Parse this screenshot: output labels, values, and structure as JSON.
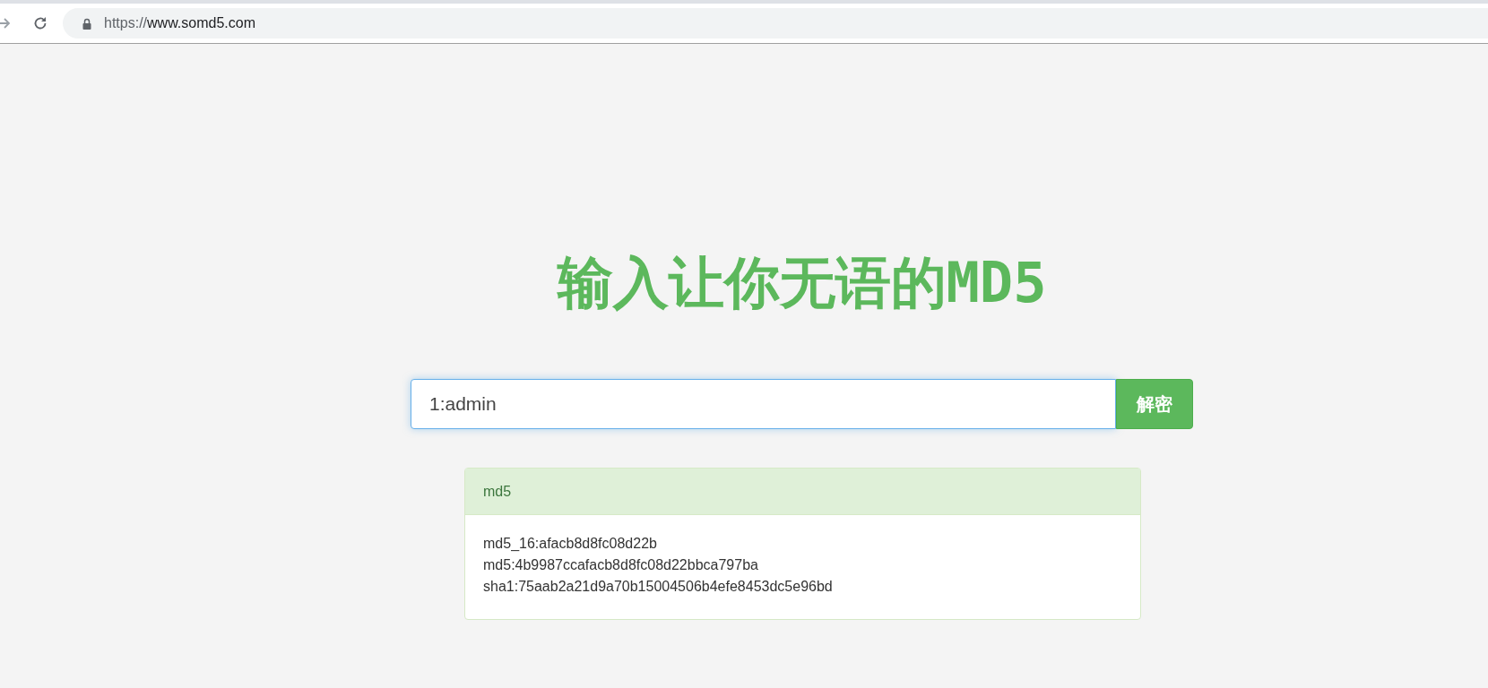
{
  "browser": {
    "url_scheme": "https://",
    "url_host": "www.somd5.com"
  },
  "page": {
    "title": "输入让你无语的MD5",
    "search": {
      "value": "1:admin",
      "button": "解密"
    },
    "result": {
      "heading": "md5",
      "lines": [
        "md5_16:afacb8d8fc08d22b",
        "md5:4b9987ccafacb8d8fc08d22bbca797ba",
        "sha1:75aab2a21d9a70b15004506b4efe8453dc5e96bd"
      ]
    }
  }
}
